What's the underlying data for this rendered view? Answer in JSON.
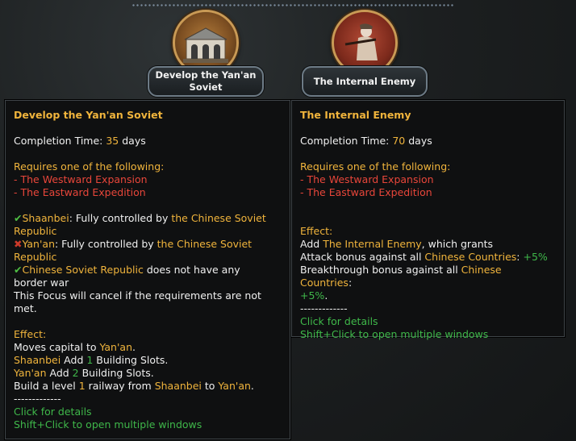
{
  "focus_nodes": [
    {
      "label_line1": "Develop the Yan'an",
      "label_line2": "Soviet",
      "emblem_icon": "yanan-building-icon"
    },
    {
      "label": "The Internal Enemy",
      "emblem_icon": "soldier-icon"
    }
  ],
  "left_tooltip": {
    "title": "Develop the Yan'an Soviet",
    "completion_label": "Completion Time: ",
    "completion_value": "35",
    "completion_unit": " days",
    "requires_label": "Requires one of the following:",
    "req1": "- The Westward Expansion",
    "req2": "- The Eastward Expedition",
    "cond1_name": "Shaanbei",
    "cond1_text": ": Fully controlled by ",
    "cond1_owner": "the Chinese Soviet",
    "cond1_owner2": "Republic",
    "cond2_name": "Yan'an",
    "cond2_text": ": Fully controlled by ",
    "cond2_owner": "the Chinese Soviet",
    "cond2_owner2": "Republic",
    "cond3_name": "Chinese Soviet Republic",
    "cond3_text": " does not have any",
    "cond3_text2": "border war",
    "cancel_line1": "This Focus will cancel if the requirements are not",
    "cancel_line2": "met.",
    "effect_label": "Effect:",
    "eff1_text": "Moves capital to ",
    "eff1_place": "Yan'an",
    "eff1_end": ".",
    "eff2_place": "Shaanbei",
    "eff2_add": " Add ",
    "eff2_num": "1",
    "eff2_end": " Building Slots.",
    "eff3_place": "Yan'an",
    "eff3_add": " Add ",
    "eff3_num": "2",
    "eff3_end": " Building Slots.",
    "eff4_text": "Build a level ",
    "eff4_num": "1",
    "eff4_mid": " railway from ",
    "eff4_from": "Shaanbei",
    "eff4_to_word": " to ",
    "eff4_to": "Yan'an",
    "eff4_end": ".",
    "separator": "-------------",
    "click_details": "Click for details",
    "shift_click": "Shift+Click to open multiple windows"
  },
  "right_tooltip": {
    "title": "The Internal Enemy",
    "completion_label": "Completion Time: ",
    "completion_value": "70",
    "completion_unit": " days",
    "requires_label": "Requires one of the following:",
    "req1": "- The Westward Expansion",
    "req2": "- The Eastward Expedition",
    "effect_label": "Effect:",
    "eff1_add": "Add ",
    "eff1_name": "The Internal Enemy",
    "eff1_end": ", which grants",
    "eff2_text": "Attack bonus against all ",
    "eff2_target": "Chinese Countries",
    "eff2_colon": ": ",
    "eff2_value": "+5%",
    "eff3_text": "Breakthrough bonus against all ",
    "eff3_target": "Chinese Countries",
    "eff3_colon": ":",
    "eff3_value": "+5%",
    "eff3_end": ".",
    "separator": "-------------",
    "click_details": "Click for details",
    "shift_click": "Shift+Click to open multiple windows"
  },
  "colors": {
    "highlight_yellow": "#f0b43c",
    "requirement_red": "#e8463a",
    "positive_green": "#3fb84a",
    "tooltip_bg": "#0f1011"
  }
}
